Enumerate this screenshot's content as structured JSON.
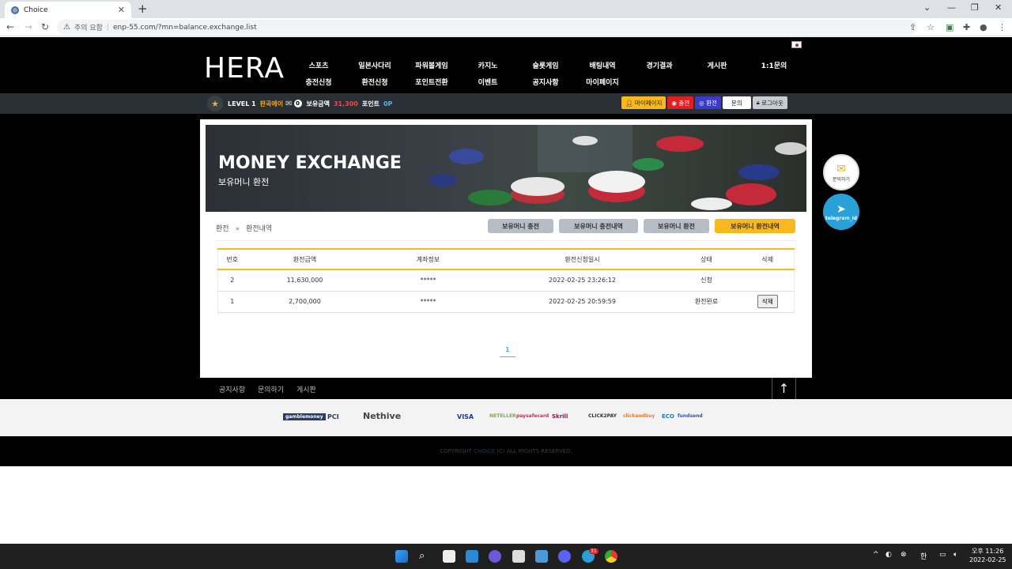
{
  "browser": {
    "tab_title": "Choice",
    "tab_close": "✕",
    "new_tab": "+",
    "security_label": "주의 요함",
    "url": "enp-55.com/?mn=balance.exchange.list"
  },
  "header": {
    "logo": "HERA",
    "menu_row1": [
      "스포츠",
      "일본사다리",
      "파워볼게임",
      "카지노",
      "슬롯게임",
      "배팅내역",
      "경기결과",
      "게시판",
      "1:1문의"
    ],
    "menu_row2": [
      "충전신청",
      "환전신청",
      "포인트전환",
      "이벤트",
      "공지사항",
      "마이페이지"
    ]
  },
  "userbar": {
    "level": "LEVEL 1",
    "nickname": "판곡에이",
    "msg_count": "0",
    "balance_label": "보유금액",
    "balance": "31,300",
    "point_label": "포인트",
    "point": "0P",
    "buttons": [
      "마이페이지",
      "충전",
      "환전",
      "문의",
      "로그아웃"
    ]
  },
  "banner": {
    "title": "MONEY EXCHANGE",
    "subtitle": "보유머니 환전"
  },
  "breadcrumb": {
    "root": "환전",
    "arrow": "»",
    "current": "환전내역"
  },
  "sub_buttons": [
    "보유머니 충전",
    "보유머니 충전내역",
    "보유머니 환전",
    "보유머니 환전내역"
  ],
  "table": {
    "headers": [
      "번호",
      "환전금액",
      "계좌정보",
      "환전신청일시",
      "상태",
      "삭제"
    ],
    "rows": [
      {
        "no": "2",
        "amount": "11,630,000",
        "account": "*****",
        "date": "2022-02-25 23:26:12",
        "status": "신청",
        "delete": ""
      },
      {
        "no": "1",
        "amount": "2,700,000",
        "account": "*****",
        "date": "2022-02-25 20:59:59",
        "status": "환전완료",
        "delete": "삭제"
      }
    ]
  },
  "pager": {
    "current": "1"
  },
  "floaters": {
    "inquiry": "문의하기",
    "telegram": "telegram_id"
  },
  "footer_links": [
    "공지사항",
    "문의하기",
    "게시판"
  ],
  "payment_logos": [
    "gamblemoney",
    "PCI",
    "Nethive",
    "VISA",
    "NETELLER",
    "paysafecard",
    "Skrill",
    "CLICK2PAY",
    "clickandbuy",
    "ECO",
    "fundsend"
  ],
  "copyright": {
    "prefix": "COPYRIGHT",
    "brand": "CHOICE",
    "suffix": "(C) ALL RIGHTS RESERVED."
  },
  "taskbar": {
    "ampm": "오후 11:26",
    "date": "2022-02-25",
    "ime": "한",
    "chat_badge": "31"
  },
  "colors": {
    "accent": "#f8b81e",
    "charge": "#e02020",
    "exchange": "#3a3acb",
    "point": "#4ab8e8"
  }
}
